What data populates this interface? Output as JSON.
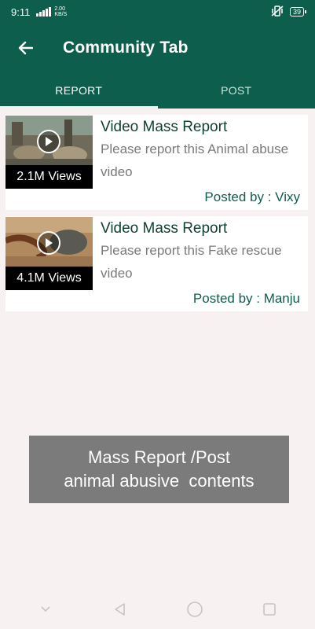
{
  "status_bar": {
    "time": "9:11",
    "net_speed_value": "2.00",
    "net_speed_unit": "KB/S",
    "battery": "39"
  },
  "app_bar": {
    "title": "Community Tab",
    "back_icon": "arrow-left-icon"
  },
  "tabs": [
    {
      "label": "REPORT",
      "active": true
    },
    {
      "label": "POST",
      "active": false
    }
  ],
  "reports": [
    {
      "title": "Video Mass Report",
      "description": "Please report this Animal abuse video",
      "views": "2.1M Views",
      "posted_by": "Posted by : Vixy"
    },
    {
      "title": "Video Mass Report",
      "description": "Please report this Fake rescue video",
      "views": "4.1M Views",
      "posted_by": "Posted by : Manju"
    }
  ],
  "banner": {
    "line1": "Mass Report /Post",
    "line2": "animal abusive  contents"
  },
  "nav_bar": {
    "icons": [
      "chevron-down-icon",
      "back-triangle-icon",
      "home-circle-icon",
      "recents-square-icon"
    ]
  },
  "colors": {
    "primary": "#0d5e4c",
    "background": "#f7f1f1",
    "banner": "#7b7b7b"
  }
}
